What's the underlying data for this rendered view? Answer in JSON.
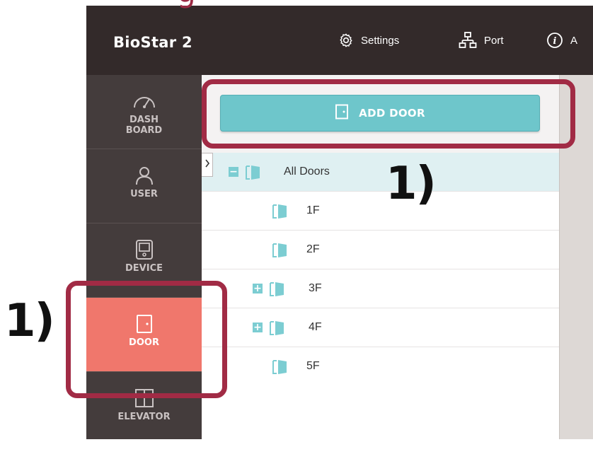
{
  "app": {
    "brand": "BioStar 2"
  },
  "header": {
    "items": [
      {
        "label": "Settings",
        "icon": "gear-icon"
      },
      {
        "label": "Port",
        "icon": "network-icon"
      },
      {
        "label": "A",
        "icon": "info-icon"
      }
    ]
  },
  "sidebar": {
    "items": [
      {
        "label": "DASH\nBOARD",
        "icon": "gauge-icon",
        "active": false
      },
      {
        "label": "USER",
        "icon": "user-icon",
        "active": false
      },
      {
        "label": "DEVICE",
        "icon": "device-icon",
        "active": false
      },
      {
        "label": "DOOR",
        "icon": "door-icon",
        "active": true
      },
      {
        "label": "ELEVATOR",
        "icon": "elevator-icon",
        "active": false
      }
    ]
  },
  "toolbar": {
    "add_door_label": "ADD DOOR"
  },
  "tree": {
    "root": {
      "label": "All Doors",
      "expanded": true,
      "selected": true
    },
    "children": [
      {
        "label": "1F",
        "expandable": false
      },
      {
        "label": "2F",
        "expandable": false
      },
      {
        "label": "3F",
        "expandable": true,
        "expander": "+"
      },
      {
        "label": "4F",
        "expandable": true,
        "expander": "+"
      },
      {
        "label": "5F",
        "expandable": false
      }
    ],
    "root_expander": "−"
  },
  "annotations": {
    "top_right_number": "1)",
    "left_number": "1)",
    "title_remnant": "g"
  },
  "colors": {
    "header_bg": "#332a2a",
    "sidebar_bg": "#443c3c",
    "active_nav": "#f0776c",
    "button": "#6ec6cb",
    "highlight_border": "#a12b45"
  }
}
